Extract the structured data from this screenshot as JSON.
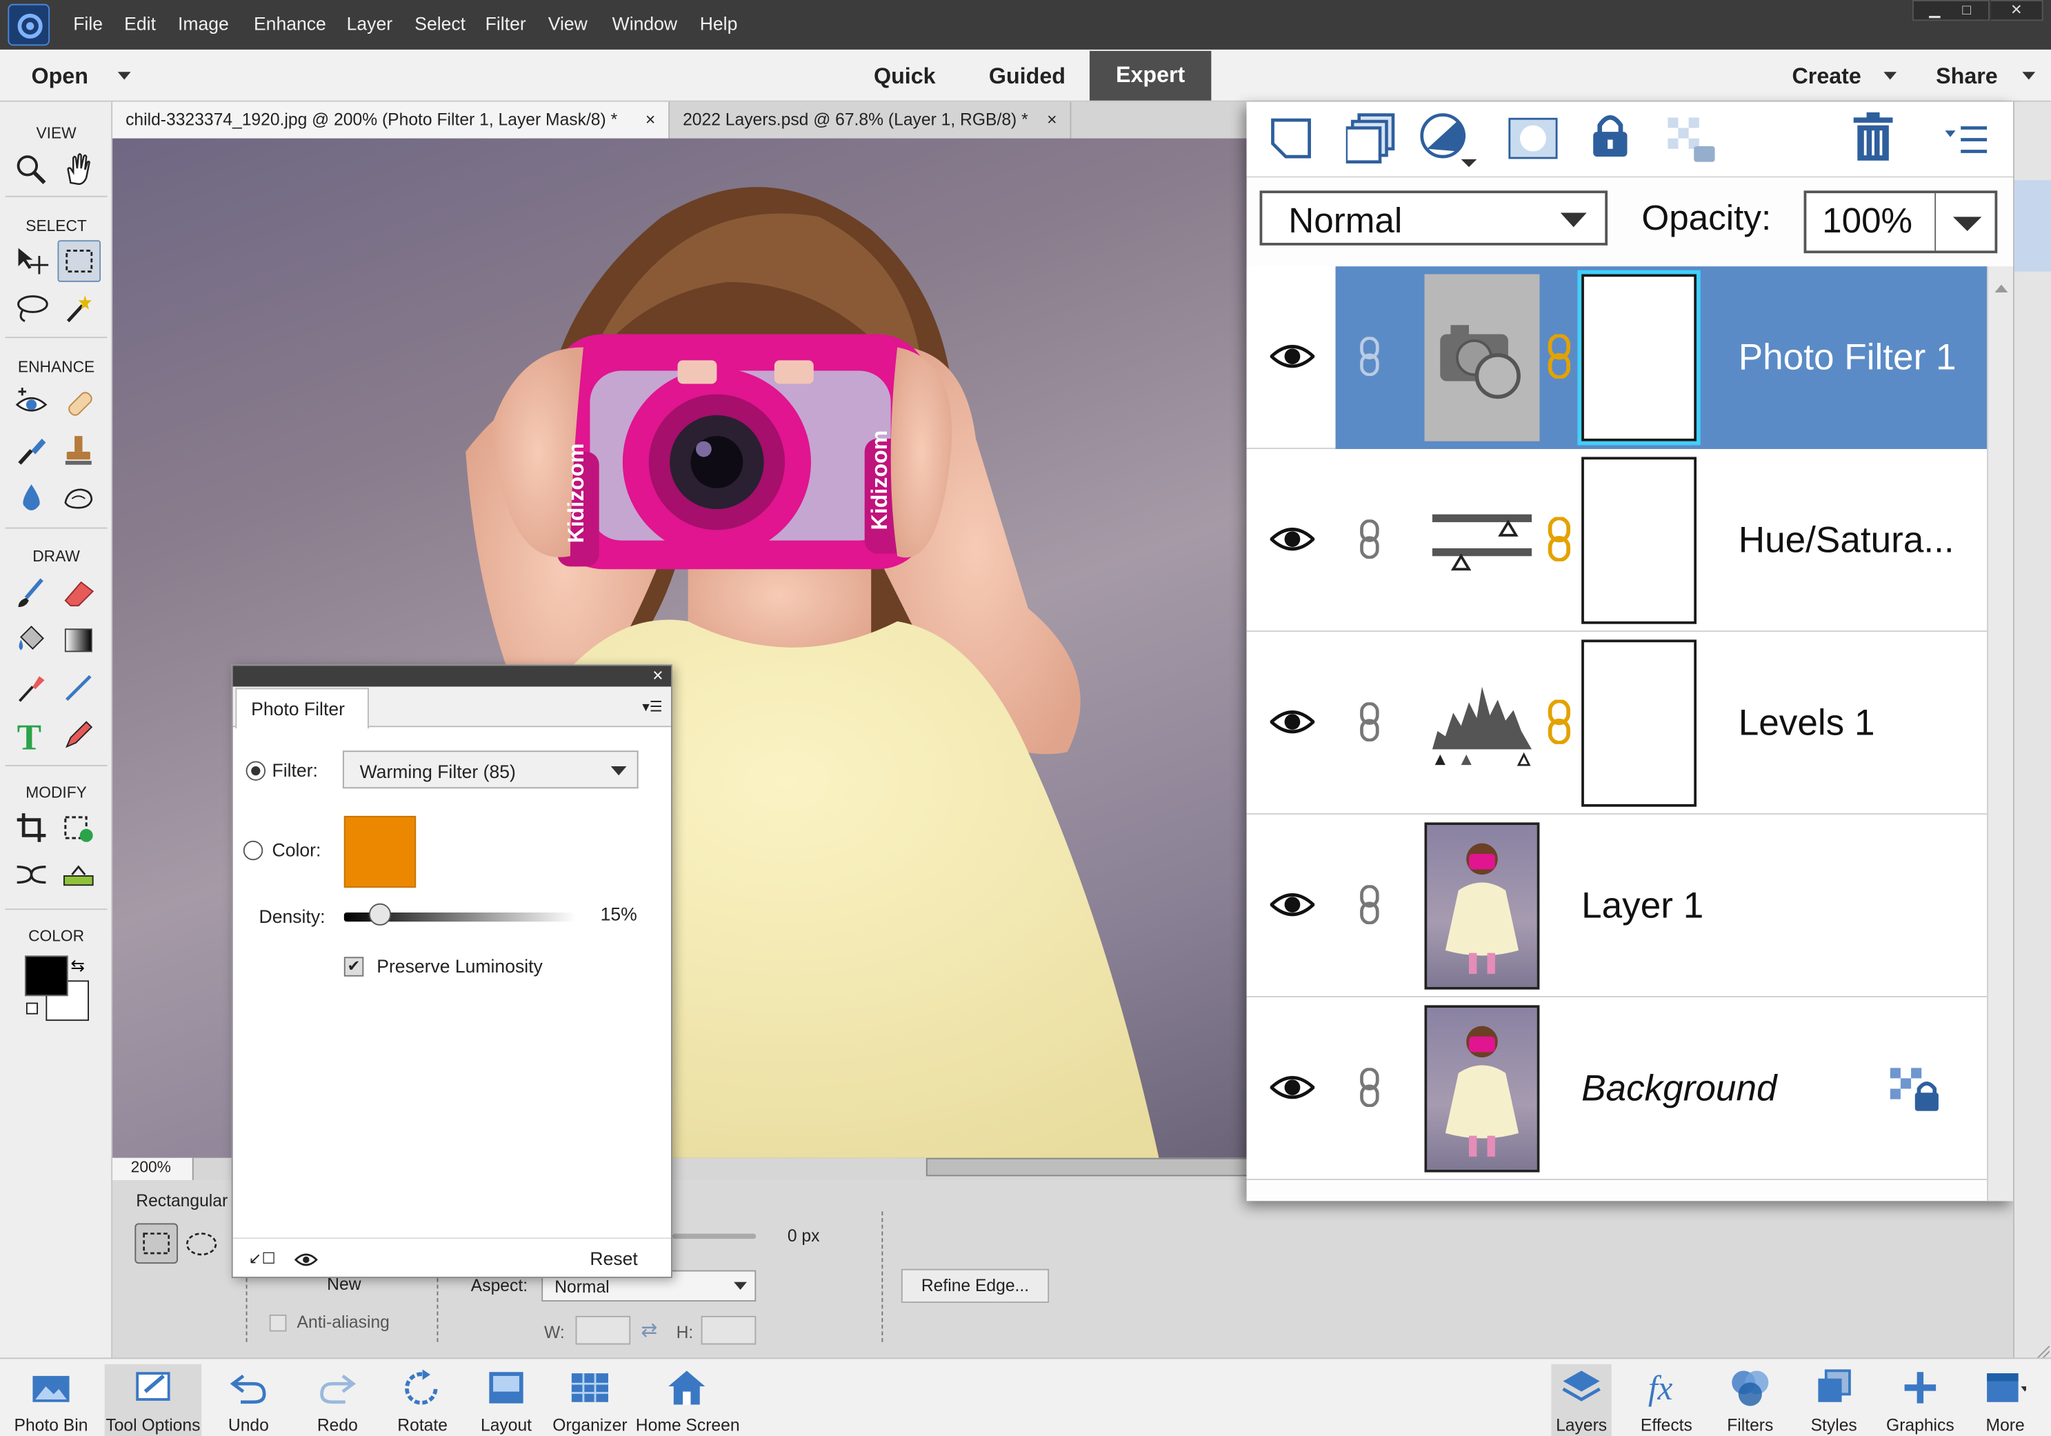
{
  "menubar": {
    "items": [
      "File",
      "Edit",
      "Image",
      "Enhance",
      "Layer",
      "Select",
      "Filter",
      "View",
      "Window",
      "Help"
    ]
  },
  "modebar": {
    "open": "Open",
    "modes": [
      "Quick",
      "Guided",
      "Expert"
    ],
    "create": "Create",
    "share": "Share"
  },
  "toolbox": {
    "sections": [
      "VIEW",
      "SELECT",
      "ENHANCE",
      "DRAW",
      "MODIFY",
      "COLOR"
    ]
  },
  "tabs": [
    {
      "title": "child-3323374_1920.jpg @ 200% (Photo Filter 1, Layer Mask/8) *",
      "close": "×"
    },
    {
      "title": "2022 Layers.psd @ 67.8% (Layer 1, RGB/8) *",
      "close": "×"
    }
  ],
  "canvas": {
    "camera_brand": "Kidizoom"
  },
  "status": {
    "zoom": "200%"
  },
  "tool_options": {
    "tool_name": "Rectangular",
    "feather_value": "0 px",
    "new_label": "New",
    "aspect_label": "Aspect:",
    "aspect_value": "Normal",
    "anti_aliasing": "Anti-aliasing",
    "w_label": "W:",
    "h_label": "H:",
    "refine_edge": "Refine Edge..."
  },
  "photo_filter": {
    "title": "Photo Filter",
    "filter_label": "Filter:",
    "filter_value": "Warming Filter (85)",
    "color_label": "Color:",
    "swatch_color": "#ec8800",
    "density_label": "Density:",
    "density_value": "15%",
    "density_fraction": 0.15,
    "preserve_luminosity": "Preserve Luminosity",
    "preserve_checked": true,
    "reset": "Reset",
    "close": "×"
  },
  "layers_panel": {
    "blend_mode": "Normal",
    "opacity_label": "Opacity:",
    "opacity_value": "100%",
    "layers": [
      {
        "name": "Photo Filter 1",
        "type": "photo-filter",
        "selected": true
      },
      {
        "name": "Hue/Satura...",
        "type": "hue-saturation",
        "selected": false
      },
      {
        "name": "Levels 1",
        "type": "levels",
        "selected": false
      },
      {
        "name": "Layer 1",
        "type": "pixel",
        "selected": false
      },
      {
        "name": "Background",
        "type": "background",
        "selected": false,
        "locked": true
      }
    ]
  },
  "bottombar": {
    "left": [
      "Photo Bin",
      "Tool Options",
      "Undo",
      "Redo",
      "Rotate",
      "Layout",
      "Organizer",
      "Home Screen"
    ],
    "right": [
      "Layers",
      "Effects",
      "Filters",
      "Styles",
      "Graphics",
      "More"
    ]
  },
  "colors": {
    "accent_blue": "#5b8bc6",
    "selection_blue": "#4f86d0",
    "foreground": "#000000",
    "background": "#ffffff"
  }
}
